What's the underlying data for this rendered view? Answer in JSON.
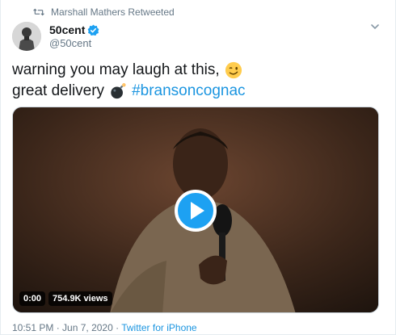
{
  "retweet": {
    "label": "Marshall Mathers Retweeted"
  },
  "author": {
    "name": "50cent",
    "handle": "@50cent",
    "verified": true
  },
  "tweet": {
    "line1": "warning you may laugh at this,",
    "line2": "great delivery",
    "hashtag": "#bransoncognac",
    "emojis": [
      "winking-face",
      "bomb"
    ]
  },
  "media": {
    "time": "0:00",
    "views": "754.9K views",
    "play_color": "#1da1f2"
  },
  "meta": {
    "time": "10:51 PM",
    "separator": " · ",
    "date": "Jun 7, 2020",
    "source": "Twitter for iPhone"
  },
  "colors": {
    "accent": "#1b95e0",
    "secondary_text": "#657786",
    "primary_text": "#14171a"
  }
}
